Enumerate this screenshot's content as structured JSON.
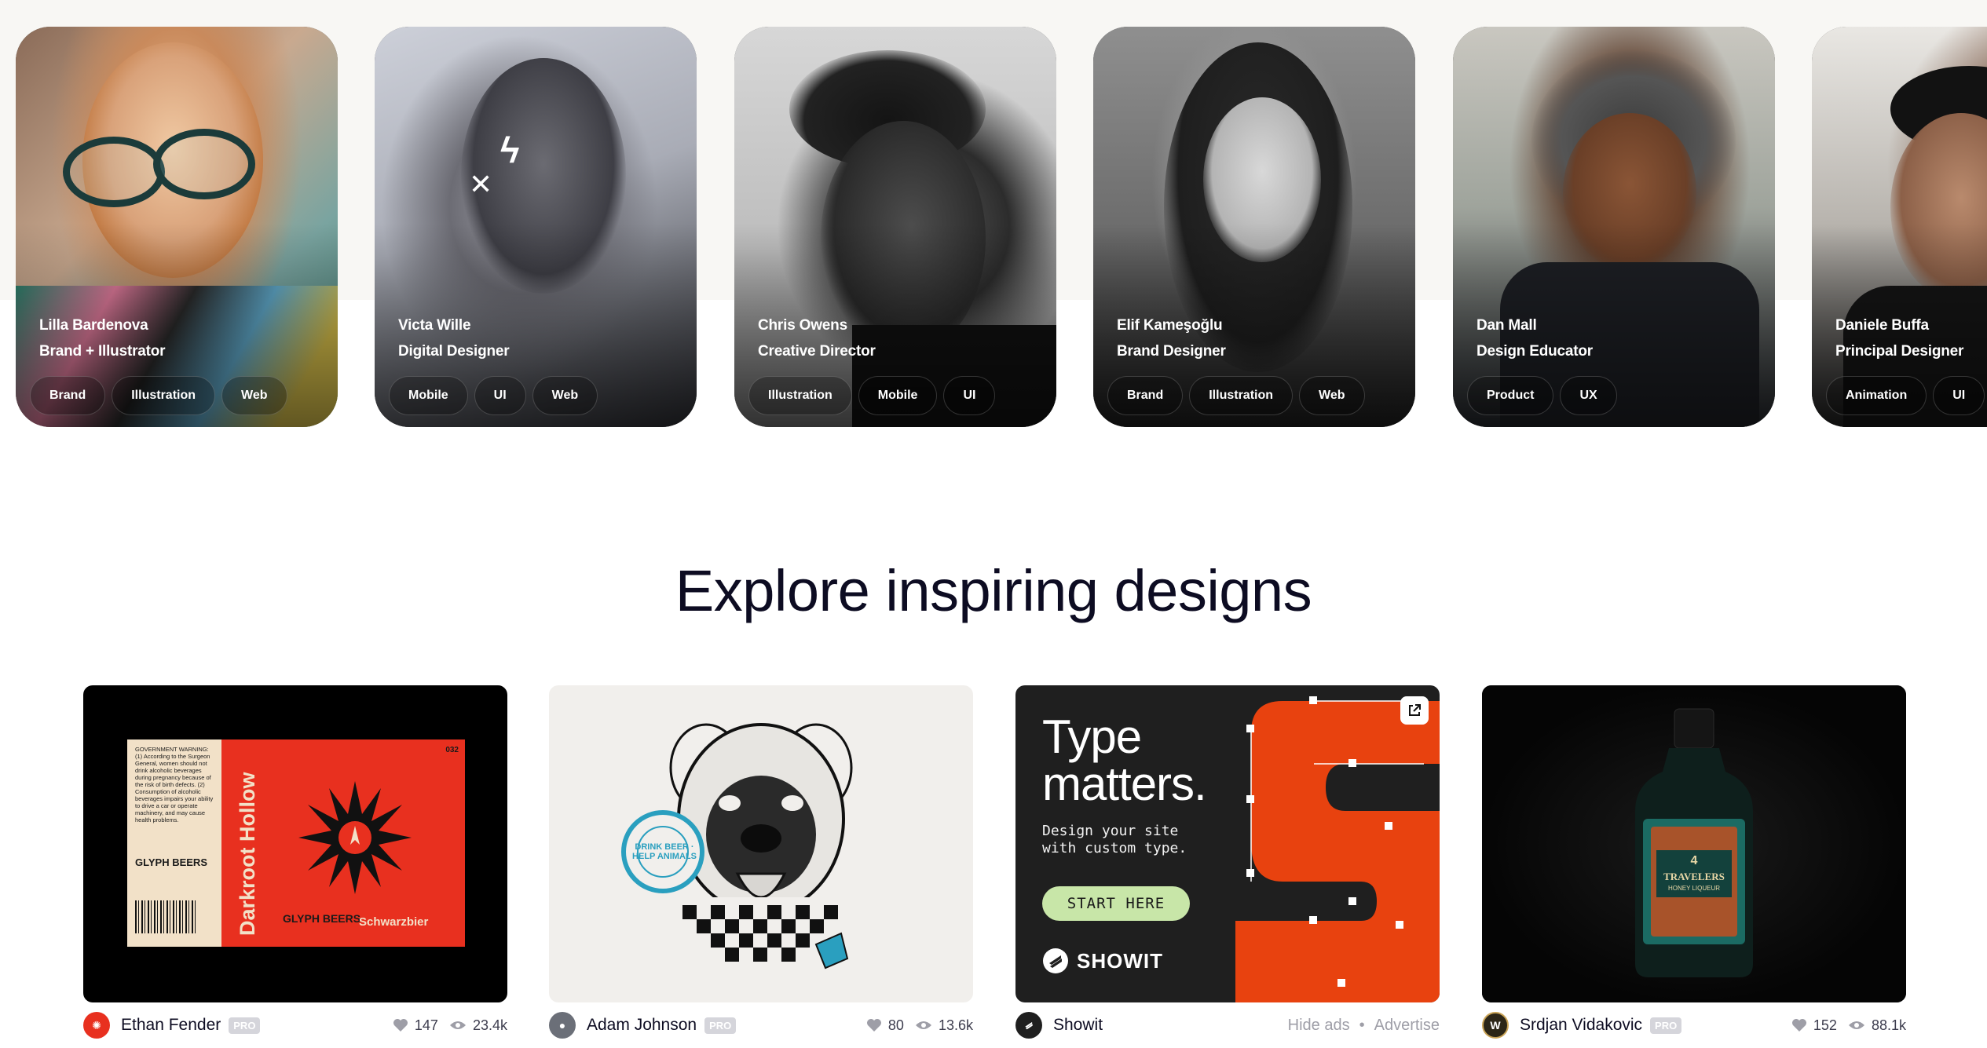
{
  "designers": [
    {
      "name": "Lilla Bardenova",
      "role": "Brand + Illustrator",
      "tags": [
        "Brand",
        "Illustration",
        "Web"
      ]
    },
    {
      "name": "Victa Wille",
      "role": "Digital Designer",
      "tags": [
        "Mobile",
        "UI",
        "Web"
      ]
    },
    {
      "name": "Chris Owens",
      "role": "Creative Director",
      "tags": [
        "Illustration",
        "Mobile",
        "UI"
      ]
    },
    {
      "name": "Elif Kameşoğlu",
      "role": "Brand Designer",
      "tags": [
        "Brand",
        "Illustration",
        "Web"
      ]
    },
    {
      "name": "Dan Mall",
      "role": "Design Educator",
      "tags": [
        "Product",
        "UX"
      ]
    },
    {
      "name": "Daniele Buffa",
      "role": "Principal Designer",
      "tags": [
        "Animation",
        "UI"
      ]
    }
  ],
  "section": {
    "heading": "Explore inspiring designs"
  },
  "shots": [
    {
      "author": "Ethan Fender",
      "badge": "PRO",
      "likes": "147",
      "views": "23.4k",
      "artwork": {
        "warning": "GOVERNMENT WARNING: (1) According to the Surgeon General, women should not drink alcoholic beverages during pregnancy because of the risk of birth defects. (2) Consumption of alcoholic beverages impairs your ability to drive a car or operate machinery, and may cause health problems.",
        "brand": "GLYPH BEERS",
        "title": "Darkroot Hollow",
        "style": "Schwarzbier",
        "number": "032"
      }
    },
    {
      "author": "Adam Johnson",
      "badge": "PRO",
      "likes": "80",
      "views": "13.6k",
      "artwork": {
        "stamp": "DRINK BEER · HELP ANIMALS"
      }
    },
    {
      "author": "Showit",
      "ad_hide": "Hide ads",
      "ad_sep": "•",
      "ad_advertise": "Advertise",
      "artwork": {
        "line1": "Type",
        "line2": "matters.",
        "sub1": "Design your site",
        "sub2": "with custom type.",
        "cta": "START HERE",
        "brand": "SHOWIT"
      }
    },
    {
      "author": "Srdjan Vidakovic",
      "badge": "PRO",
      "likes": "152",
      "views": "88.1k",
      "artwork": {
        "bottle_label_1": "4",
        "bottle_label_2": "TRAVELERS",
        "bottle_label_3": "HONEY LIQUEUR"
      }
    }
  ],
  "colors": {
    "accent": "#ea4c89",
    "ink": "#0d0c22",
    "muted": "#9e9ea7",
    "label_red": "#e8301f",
    "cta_green": "#c8e6a8"
  }
}
